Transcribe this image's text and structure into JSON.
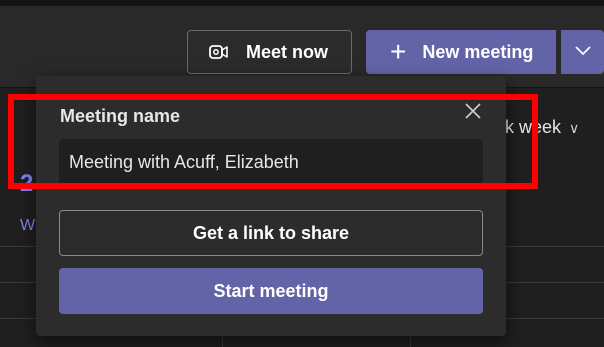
{
  "toolbar": {
    "meet_now_label": "Meet now",
    "meet_now_icon": "video-camera-icon",
    "new_meeting_label": "New meeting",
    "new_meeting_icon": "plus-icon",
    "dropdown_icon": "chevron-down-icon"
  },
  "calendar": {
    "view_label": "k week",
    "day_number": "2",
    "day_label": "W"
  },
  "popover": {
    "title": "Meeting name",
    "close_icon": "close-icon",
    "meeting_name_value": "Meeting with Acuff, Elizabeth",
    "get_link_label": "Get a link to share",
    "start_label": "Start meeting"
  },
  "colors": {
    "accent": "#6264a7",
    "highlight": "#ff0000"
  }
}
